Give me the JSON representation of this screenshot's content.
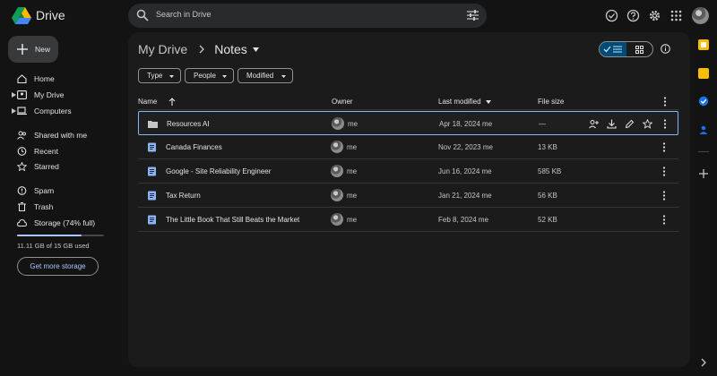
{
  "app": {
    "title": "Drive"
  },
  "search": {
    "placeholder": "Search in Drive"
  },
  "sidebar": {
    "new_label": "New",
    "items": [
      {
        "label": "Home"
      },
      {
        "label": "My Drive"
      },
      {
        "label": "Computers"
      },
      {
        "label": "Shared with me"
      },
      {
        "label": "Recent"
      },
      {
        "label": "Starred"
      },
      {
        "label": "Spam"
      },
      {
        "label": "Trash"
      },
      {
        "label": "Storage (74% full)"
      }
    ],
    "storage": {
      "used_text": "11.11 GB of 15 GB used",
      "percent": 74,
      "button": "Get more storage"
    }
  },
  "main": {
    "breadcrumb": {
      "root": "My Drive",
      "current": "Notes"
    },
    "filters": [
      "Type",
      "People",
      "Modified"
    ],
    "columns": {
      "name": "Name",
      "owner": "Owner",
      "modified": "Last modified",
      "size": "File size"
    },
    "rows": [
      {
        "name": "Resources AI",
        "type": "folder",
        "owner": "me",
        "modified": "Apr 18, 2024 me",
        "size": "—"
      },
      {
        "name": "Canada Finances",
        "type": "doc",
        "owner": "me",
        "modified": "Nov 22, 2023 me",
        "size": "13 KB"
      },
      {
        "name": "Google - Site Reliability Engineer",
        "type": "doc",
        "owner": "me",
        "modified": "Jun 16, 2024 me",
        "size": "585 KB"
      },
      {
        "name": "Tax Return",
        "type": "doc",
        "owner": "me",
        "modified": "Jan 21, 2024 me",
        "size": "56 KB"
      },
      {
        "name": "The Little Book That Still Beats the Market",
        "type": "doc",
        "owner": "me",
        "modified": "Feb 8, 2024 me",
        "size": "52 KB"
      }
    ]
  },
  "colors": {
    "accent": "#a8c7fa",
    "doc_blue": "#8ab4f8",
    "selected_view": "#004a77"
  }
}
